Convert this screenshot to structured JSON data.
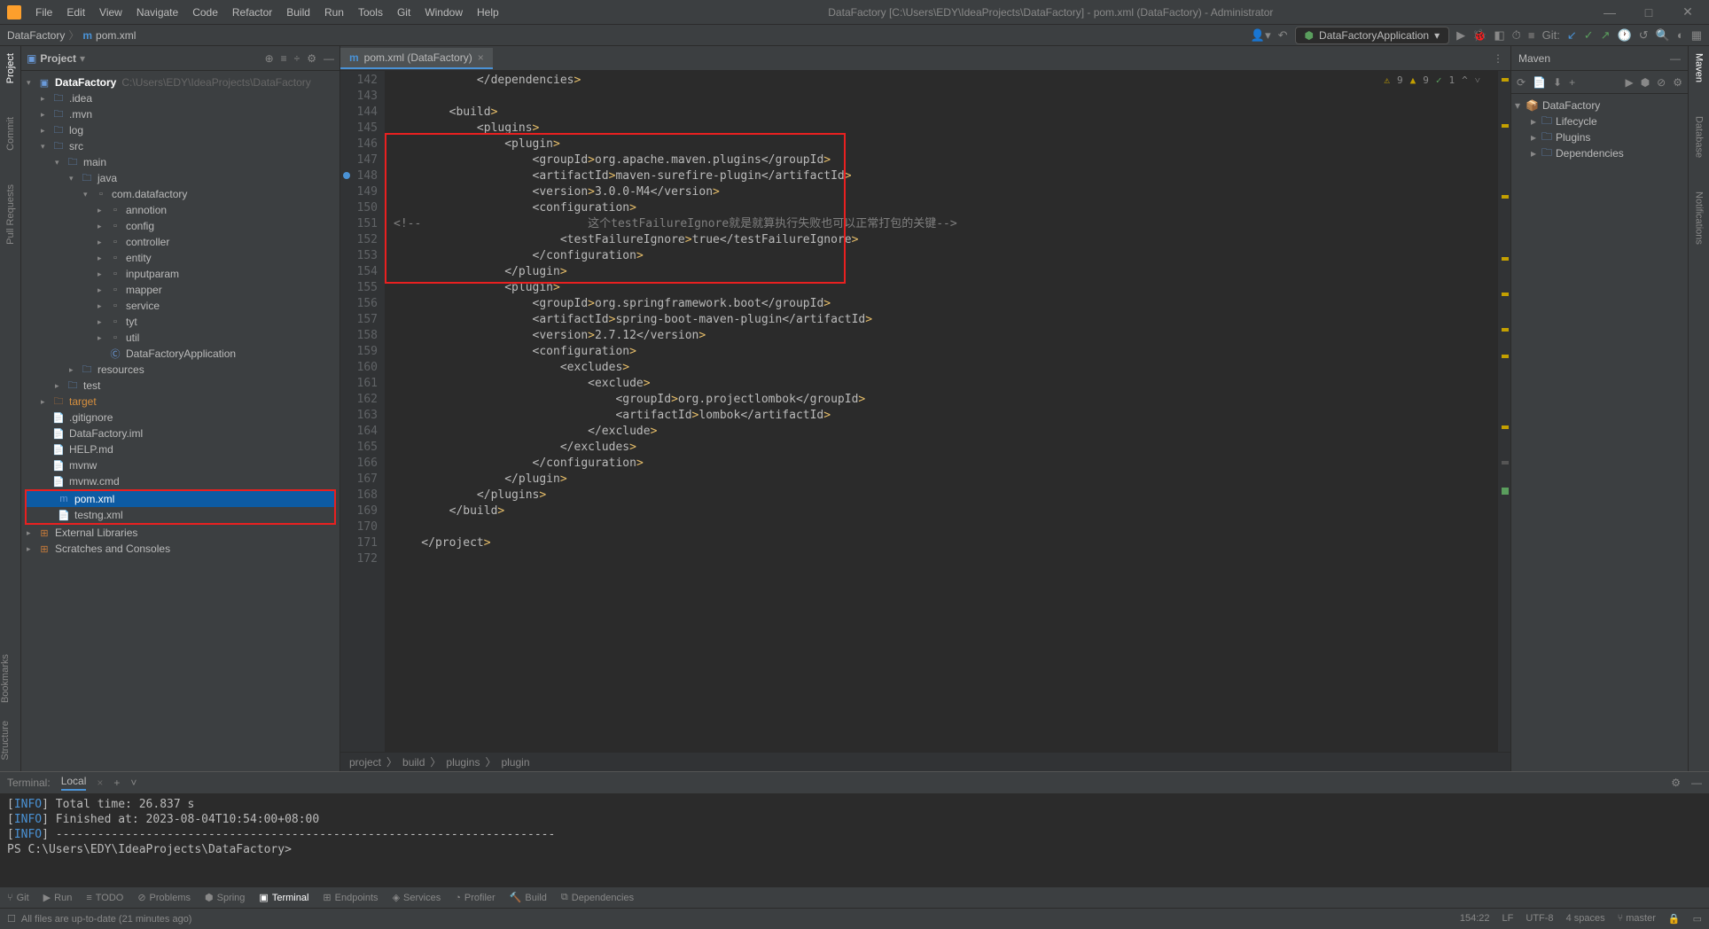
{
  "menubar": [
    "File",
    "Edit",
    "View",
    "Navigate",
    "Code",
    "Refactor",
    "Build",
    "Run",
    "Tools",
    "Git",
    "Window",
    "Help"
  ],
  "title": "DataFactory [C:\\Users\\EDY\\IdeaProjects\\DataFactory] - pom.xml (DataFactory) - Administrator",
  "breadcrumb": {
    "project": "DataFactory",
    "file": "pom.xml"
  },
  "run_config": "DataFactoryApplication",
  "git_label": "Git:",
  "project_panel": {
    "label": "Project"
  },
  "tree": {
    "root": "DataFactory",
    "root_path": "C:\\Users\\EDY\\IdeaProjects\\DataFactory",
    "items": [
      {
        "l": 1,
        "t": "folder",
        "n": ".idea"
      },
      {
        "l": 1,
        "t": "folder",
        "n": ".mvn"
      },
      {
        "l": 1,
        "t": "folder",
        "n": "log"
      },
      {
        "l": 1,
        "t": "folder",
        "n": "src",
        "open": true
      },
      {
        "l": 2,
        "t": "folder",
        "n": "main",
        "open": true
      },
      {
        "l": 3,
        "t": "folder-blue",
        "n": "java",
        "open": true
      },
      {
        "l": 4,
        "t": "pkg",
        "n": "com.datafactory",
        "open": true
      },
      {
        "l": 5,
        "t": "pkg",
        "n": "annotion"
      },
      {
        "l": 5,
        "t": "pkg",
        "n": "config"
      },
      {
        "l": 5,
        "t": "pkg",
        "n": "controller"
      },
      {
        "l": 5,
        "t": "pkg",
        "n": "entity"
      },
      {
        "l": 5,
        "t": "pkg",
        "n": "inputparam"
      },
      {
        "l": 5,
        "t": "pkg",
        "n": "mapper"
      },
      {
        "l": 5,
        "t": "pkg",
        "n": "service"
      },
      {
        "l": 5,
        "t": "pkg",
        "n": "tyt"
      },
      {
        "l": 5,
        "t": "pkg",
        "n": "util"
      },
      {
        "l": 5,
        "t": "class",
        "n": "DataFactoryApplication"
      },
      {
        "l": 3,
        "t": "folder",
        "n": "resources"
      },
      {
        "l": 2,
        "t": "folder",
        "n": "test"
      },
      {
        "l": 1,
        "t": "folder-orange",
        "n": "target"
      },
      {
        "l": 1,
        "t": "file",
        "n": ".gitignore"
      },
      {
        "l": 1,
        "t": "file-orange",
        "n": "DataFactory.iml"
      },
      {
        "l": 1,
        "t": "file-green",
        "n": "HELP.md"
      },
      {
        "l": 1,
        "t": "file",
        "n": "mvnw"
      },
      {
        "l": 1,
        "t": "file",
        "n": "mvnw.cmd"
      },
      {
        "l": 1,
        "t": "file-m",
        "n": "pom.xml",
        "sel": true,
        "boxed": true
      },
      {
        "l": 1,
        "t": "file-red",
        "n": "testng.xml",
        "boxed": true
      }
    ],
    "extlib": "External Libraries",
    "scratches": "Scratches and Consoles"
  },
  "editor_tab": "pom.xml (DataFactory)",
  "code_lines": [
    {
      "n": 142,
      "c": "            </dependencies>"
    },
    {
      "n": 143,
      "c": ""
    },
    {
      "n": 144,
      "c": "        <build>"
    },
    {
      "n": 145,
      "c": "            <plugins>"
    },
    {
      "n": 146,
      "c": "                <plugin>",
      "boxed": true
    },
    {
      "n": 147,
      "c": "                    <groupId>org.apache.maven.plugins</groupId>"
    },
    {
      "n": 148,
      "c": "                    <artifactId>maven-surefire-plugin</artifactId>",
      "bp": true
    },
    {
      "n": 149,
      "c": "                    <version>3.0.0-M4</version>"
    },
    {
      "n": 150,
      "c": "                    <configuration>"
    },
    {
      "n": 151,
      "c": "<!--                        这个testFailureIgnore就是就算执行失败也可以正常打包的关键-->",
      "comment": true
    },
    {
      "n": 152,
      "c": "                        <testFailureIgnore>true</testFailureIgnore>"
    },
    {
      "n": 153,
      "c": "                    </configuration>"
    },
    {
      "n": 154,
      "c": "                </plugin>"
    },
    {
      "n": 155,
      "c": "                <plugin>"
    },
    {
      "n": 156,
      "c": "                    <groupId>org.springframework.boot</groupId>"
    },
    {
      "n": 157,
      "c": "                    <artifactId>spring-boot-maven-plugin</artifactId>"
    },
    {
      "n": 158,
      "c": "                    <version>2.7.12</version>"
    },
    {
      "n": 159,
      "c": "                    <configuration>"
    },
    {
      "n": 160,
      "c": "                        <excludes>"
    },
    {
      "n": 161,
      "c": "                            <exclude>"
    },
    {
      "n": 162,
      "c": "                                <groupId>org.projectlombok</groupId>"
    },
    {
      "n": 163,
      "c": "                                <artifactId>lombok</artifactId>"
    },
    {
      "n": 164,
      "c": "                            </exclude>"
    },
    {
      "n": 165,
      "c": "                        </excludes>"
    },
    {
      "n": 166,
      "c": "                    </configuration>"
    },
    {
      "n": 167,
      "c": "                </plugin>"
    },
    {
      "n": 168,
      "c": "            </plugins>"
    },
    {
      "n": 169,
      "c": "        </build>"
    },
    {
      "n": 170,
      "c": ""
    },
    {
      "n": 171,
      "c": "    </project>"
    },
    {
      "n": 172,
      "c": ""
    }
  ],
  "inspections": {
    "warn1": "9",
    "warn2": "9",
    "up": "1"
  },
  "breadcrumb_bottom": [
    "project",
    "build",
    "plugins",
    "plugin"
  ],
  "maven": {
    "title": "Maven",
    "root": "DataFactory",
    "items": [
      "Lifecycle",
      "Plugins",
      "Dependencies"
    ]
  },
  "terminal": {
    "tab_label": "Terminal:",
    "local": "Local",
    "lines": [
      {
        "pre": "[INFO] ",
        "t": "Total time:  26.837 s"
      },
      {
        "pre": "[INFO] ",
        "t": "Finished at: 2023-08-04T10:54:00+08:00"
      },
      {
        "pre": "[INFO] ",
        "t": "------------------------------------------------------------------------"
      },
      {
        "pre": "",
        "t": "PS C:\\Users\\EDY\\IdeaProjects\\DataFactory> "
      }
    ]
  },
  "bottom_tabs": [
    "Git",
    "Run",
    "TODO",
    "Problems",
    "Spring",
    "Terminal",
    "Endpoints",
    "Services",
    "Profiler",
    "Build",
    "Dependencies"
  ],
  "status": {
    "msg": "All files are up-to-date (21 minutes ago)",
    "pos": "154:22",
    "lf": "LF",
    "enc": "UTF-8",
    "indent": "4 spaces",
    "branch": "master"
  },
  "left_tabs": [
    "Project",
    "Commit",
    "Pull Requests"
  ],
  "left_tabs_bottom": [
    "Bookmarks",
    "Structure"
  ],
  "right_tabs": [
    "Maven",
    "Database",
    "Notifications"
  ]
}
